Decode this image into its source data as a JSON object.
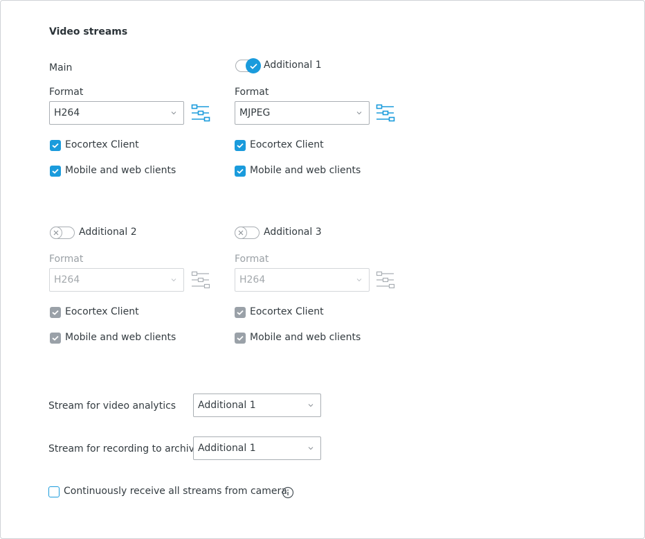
{
  "section_title": "Video streams",
  "colors": {
    "accent": "#1a9bdc",
    "disabled": "#9aa1a8",
    "text": "#333b40",
    "border": "#a9aeb3"
  },
  "streams": [
    {
      "title": "Main",
      "has_toggle": false,
      "enabled": true,
      "format_label": "Format",
      "format_value": "H264",
      "settings_icon": "settings-sliders-icon",
      "checkboxes": [
        {
          "label": "Eocortex Client",
          "checked": true
        },
        {
          "label": "Mobile and web clients",
          "checked": true
        }
      ]
    },
    {
      "title": "Additional 1",
      "has_toggle": true,
      "enabled": true,
      "format_label": "Format",
      "format_value": "MJPEG",
      "settings_icon": "settings-sliders-icon",
      "checkboxes": [
        {
          "label": "Eocortex Client",
          "checked": true
        },
        {
          "label": "Mobile and web clients",
          "checked": true
        }
      ]
    },
    {
      "title": "Additional 2",
      "has_toggle": true,
      "enabled": false,
      "format_label": "Format",
      "format_value": "H264",
      "settings_icon": "settings-sliders-icon",
      "checkboxes": [
        {
          "label": "Eocortex Client",
          "checked": true
        },
        {
          "label": "Mobile and web clients",
          "checked": true
        }
      ]
    },
    {
      "title": "Additional 3",
      "has_toggle": true,
      "enabled": false,
      "format_label": "Format",
      "format_value": "H264",
      "settings_icon": "settings-sliders-icon",
      "checkboxes": [
        {
          "label": "Eocortex Client",
          "checked": true
        },
        {
          "label": "Mobile and web clients",
          "checked": true
        }
      ]
    }
  ],
  "analytics": {
    "label": "Stream for video analytics",
    "value": "Additional 1"
  },
  "archive": {
    "label": "Stream for recording to archive",
    "value": "Additional 1"
  },
  "continuous": {
    "label": "Continuously receive all streams from camera",
    "checked": false,
    "info_icon": "info-icon"
  }
}
